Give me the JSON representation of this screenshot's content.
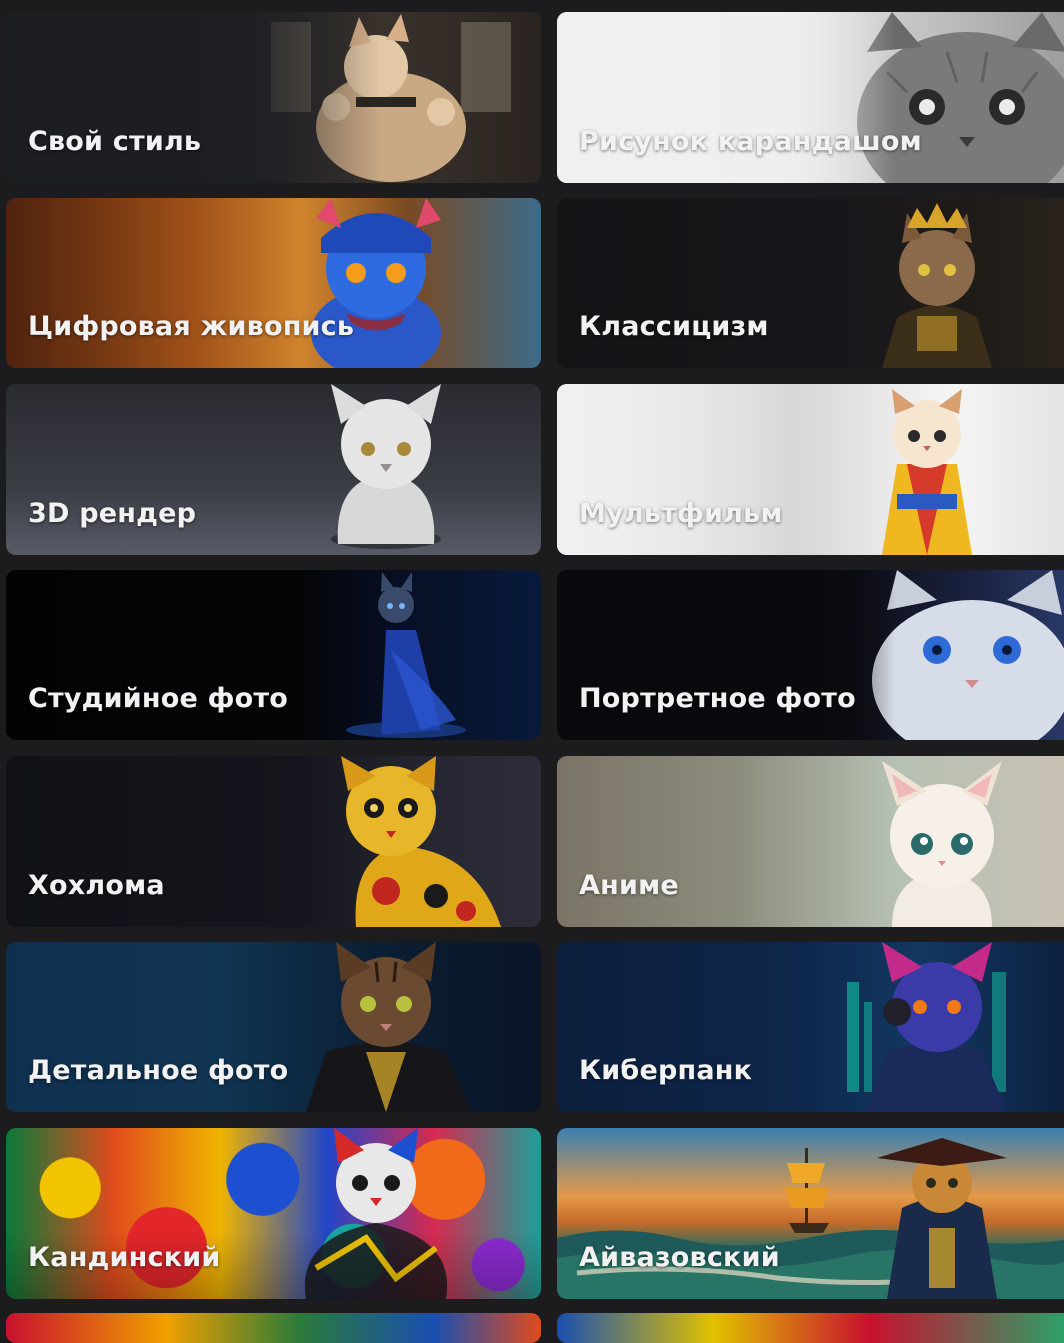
{
  "styles": [
    {
      "label": "Свой стиль"
    },
    {
      "label": "Рисунок карандашом"
    },
    {
      "label": "Цифровая живопись"
    },
    {
      "label": "Классицизм"
    },
    {
      "label": "3D рендер"
    },
    {
      "label": "Мультфильм"
    },
    {
      "label": "Студийное фото"
    },
    {
      "label": "Портретное фото"
    },
    {
      "label": "Хохлома"
    },
    {
      "label": "Аниме"
    },
    {
      "label": "Детальное фото"
    },
    {
      "label": "Киберпанк"
    },
    {
      "label": "Кандинский"
    },
    {
      "label": "Айвазовский"
    }
  ],
  "colors": {
    "page_background": "#1c1c1e",
    "label_text": "#f2f2f2"
  }
}
